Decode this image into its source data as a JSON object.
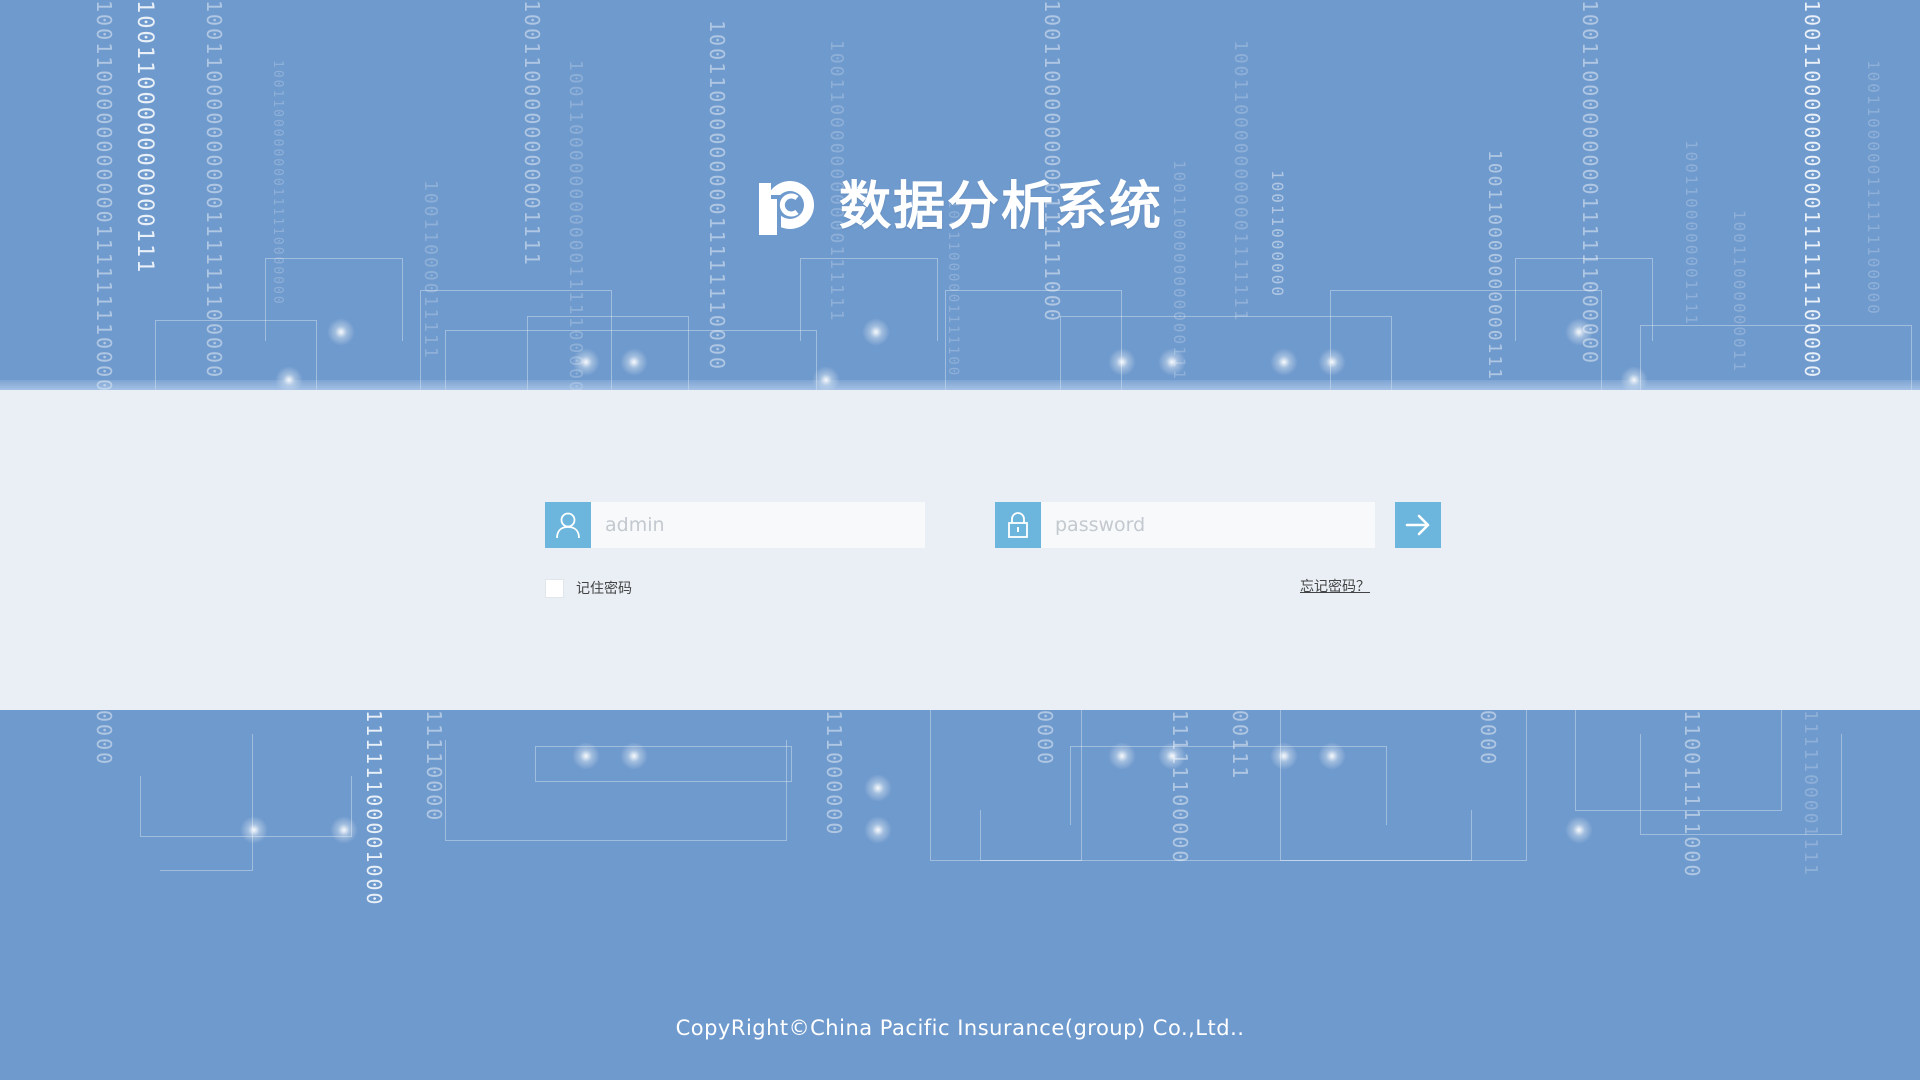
{
  "header": {
    "title": "数据分析系统",
    "logo_icon": "logo-icon"
  },
  "login": {
    "username_placeholder": "admin",
    "username_value": "",
    "username_icon": "user-icon",
    "password_placeholder": "password",
    "password_value": "",
    "password_icon": "lock-icon",
    "submit_icon": "arrow-right-icon",
    "remember_label": "记住密码",
    "remember_checked": false,
    "forgot_label": "忘记密码？"
  },
  "footer": {
    "copyright": "CopyRight©China Pacific Insurance(group) Co.,Ltd.."
  },
  "colors": {
    "background": "#6f9acd",
    "band": "#e9eff5",
    "accent": "#6cb6dd",
    "input_bg": "#f7f9fb",
    "placeholder": "#c3c9cf"
  }
}
